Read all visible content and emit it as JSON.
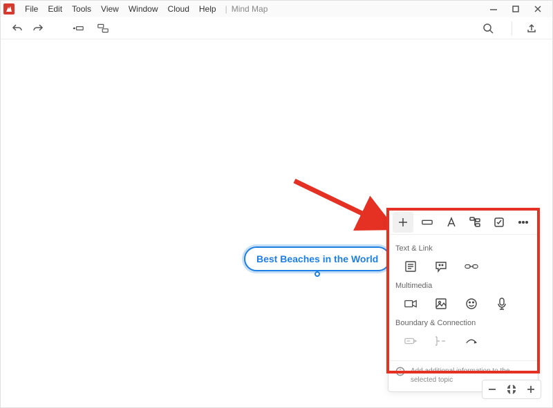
{
  "menu": {
    "file": "File",
    "edit": "Edit",
    "tools": "Tools",
    "view": "View",
    "window": "Window",
    "cloud": "Cloud",
    "help": "Help"
  },
  "tab_label": "Mind Map",
  "central_topic": "Best Beaches in the World",
  "panel": {
    "sections": {
      "text_link": "Text & Link",
      "multimedia": "Multimedia",
      "boundary_connection": "Boundary & Connection"
    },
    "footer_hint": "Add additional information to the selected topic"
  }
}
